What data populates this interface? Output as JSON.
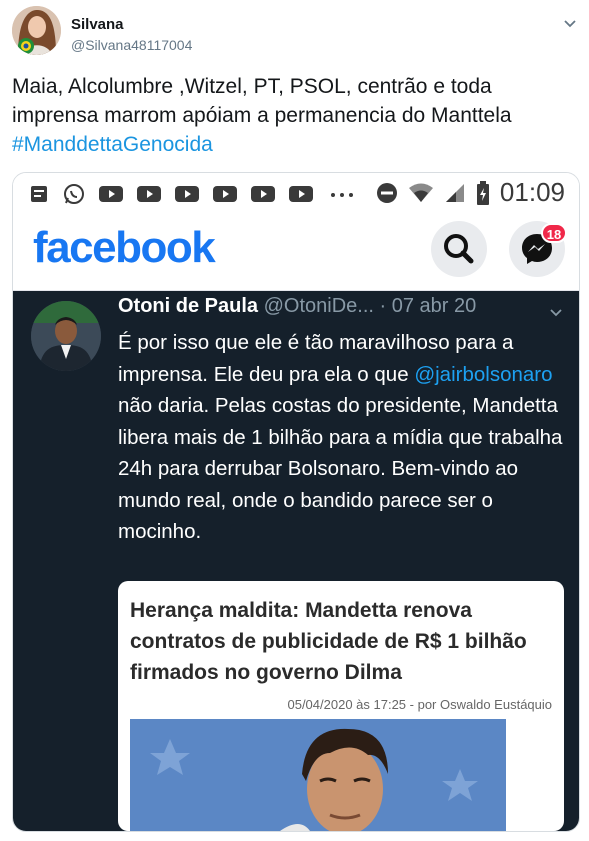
{
  "author": {
    "name": "Silvana",
    "handle": "@Silvana48117004"
  },
  "tweet": {
    "text": "Maia, Alcolumbre ,Witzel, PT, PSOL, centrão e toda imprensa marrom apóiam a permanencia  do Manttela",
    "hashtag": "#ManddettaGenocida"
  },
  "screenshot": {
    "status_bar": {
      "time": "01:09"
    },
    "facebook": {
      "logo": "facebook",
      "messenger_badge": "18"
    },
    "inner_tweet": {
      "name": "Otoni de Paula",
      "handle": "@OtoniDe...",
      "date": "· 07 abr 20",
      "text_before_mention": "É por isso que ele é tão maravilhoso para a imprensa. Ele deu pra ela o que ",
      "mention": "@jairbolsonaro",
      "text_after_mention": " não daria. Pelas costas do presidente, Mandetta libera mais de 1 bilhão para a mídia que trabalha 24h para derrubar Bolsonaro. Bem-vindo ao mundo real, onde o bandido parece ser o mocinho."
    },
    "article": {
      "title": "Herança maldita: Mandetta renova contratos de publicidade de R$ 1 bilhão firmados no governo Dilma",
      "meta": "05/04/2020 às 17:25 - por Oswaldo Eustáquio"
    }
  },
  "colors": {
    "link": "#1b95e0",
    "facebook_blue": "#1877f2",
    "dark_bg": "#15202b",
    "badge": "#f02849"
  }
}
